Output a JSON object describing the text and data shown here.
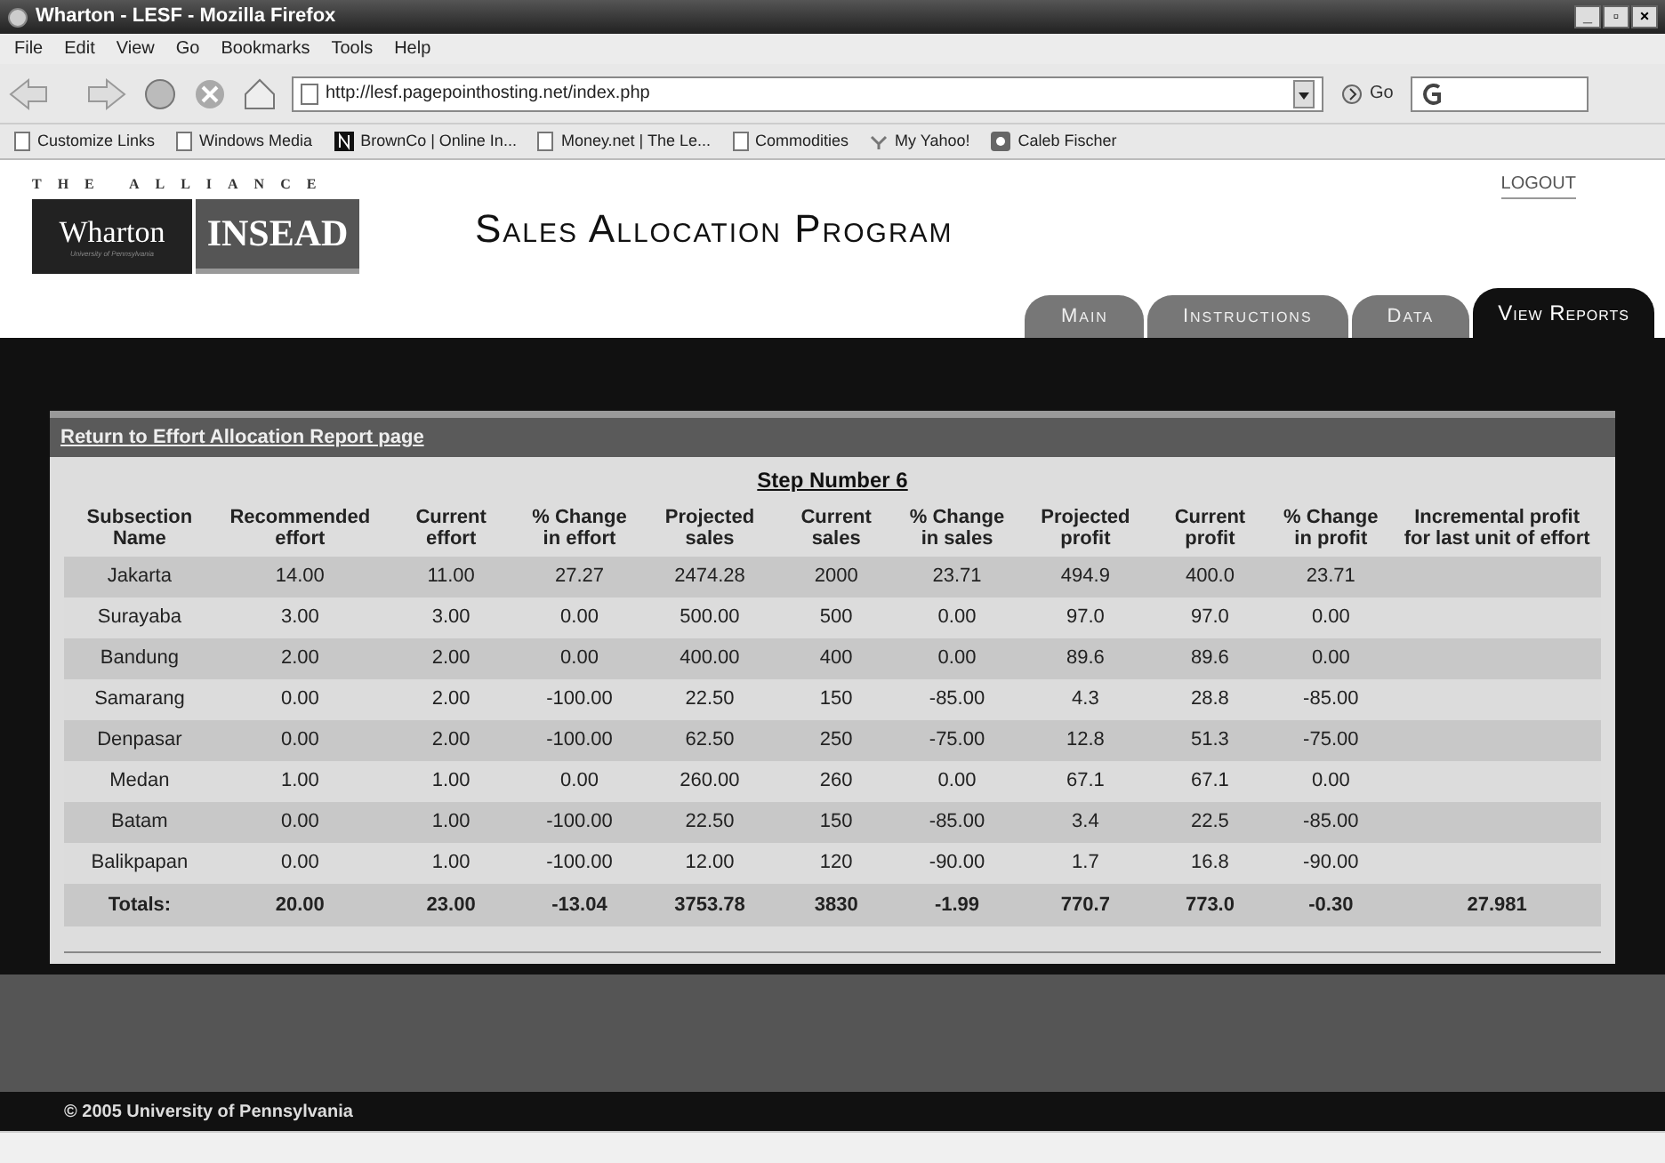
{
  "window": {
    "title": "Wharton - LESF - Mozilla Firefox",
    "controls": [
      "_",
      "▫",
      "×"
    ]
  },
  "menu": [
    "File",
    "Edit",
    "View",
    "Go",
    "Bookmarks",
    "Tools",
    "Help"
  ],
  "address_bar": {
    "url": "http://lesf.pagepointhosting.net/index.php",
    "go_label": "Go"
  },
  "bookmarks": [
    {
      "label": "Customize Links",
      "kind": "page"
    },
    {
      "label": "Windows Media",
      "kind": "page"
    },
    {
      "label": "BrownCo | Online In...",
      "kind": "dark"
    },
    {
      "label": "Money.net | The Le...",
      "kind": "page"
    },
    {
      "label": "Commodities",
      "kind": "page"
    },
    {
      "label": "My Yahoo!",
      "kind": "yahoo"
    },
    {
      "label": "Caleb Fischer",
      "kind": "badge"
    }
  ],
  "header": {
    "alliance": "THE ALLIANCE",
    "logo_left": "Wharton",
    "logo_left_sub": "University of Pennsylvania",
    "logo_right": "INSEAD",
    "title": "Sales Allocation Program",
    "logout": "LOGOUT"
  },
  "tabs": [
    {
      "label": "Main",
      "selected": false
    },
    {
      "label": "Instructions",
      "selected": false
    },
    {
      "label": "Data",
      "selected": false
    },
    {
      "label": "View Reports",
      "selected": true
    }
  ],
  "return_link": "Return to Effort Allocation Report page",
  "step_title": "Step Number 6",
  "table": {
    "columns": [
      "Subsection Name",
      "Recommended effort",
      "Current effort",
      "% Change in effort",
      "Projected sales",
      "Current sales",
      "% Change in sales",
      "Projected profit",
      "Current profit",
      "% Change in profit",
      "Incremental profit for last unit of effort"
    ],
    "rows": [
      [
        "Jakarta",
        "14.00",
        "11.00",
        "27.27",
        "2474.28",
        "2000",
        "23.71",
        "494.9",
        "400.0",
        "23.71"
      ],
      [
        "Surayaba",
        "3.00",
        "3.00",
        "0.00",
        "500.00",
        "500",
        "0.00",
        "97.0",
        "97.0",
        "0.00"
      ],
      [
        "Bandung",
        "2.00",
        "2.00",
        "0.00",
        "400.00",
        "400",
        "0.00",
        "89.6",
        "89.6",
        "0.00"
      ],
      [
        "Samarang",
        "0.00",
        "2.00",
        "-100.00",
        "22.50",
        "150",
        "-85.00",
        "4.3",
        "28.8",
        "-85.00"
      ],
      [
        "Denpasar",
        "0.00",
        "2.00",
        "-100.00",
        "62.50",
        "250",
        "-75.00",
        "12.8",
        "51.3",
        "-75.00"
      ],
      [
        "Medan",
        "1.00",
        "1.00",
        "0.00",
        "260.00",
        "260",
        "0.00",
        "67.1",
        "67.1",
        "0.00"
      ],
      [
        "Batam",
        "0.00",
        "1.00",
        "-100.00",
        "22.50",
        "150",
        "-85.00",
        "3.4",
        "22.5",
        "-85.00"
      ],
      [
        "Balikpapan",
        "0.00",
        "1.00",
        "-100.00",
        "12.00",
        "120",
        "-90.00",
        "1.7",
        "16.8",
        "-90.00"
      ]
    ],
    "totals": [
      "Totals:",
      "20.00",
      "23.00",
      "-13.04",
      "3753.78",
      "3830",
      "-1.99",
      "770.7",
      "773.0",
      "-0.30",
      "27.981"
    ]
  },
  "footer": "© 2005 University of Pennsylvania"
}
